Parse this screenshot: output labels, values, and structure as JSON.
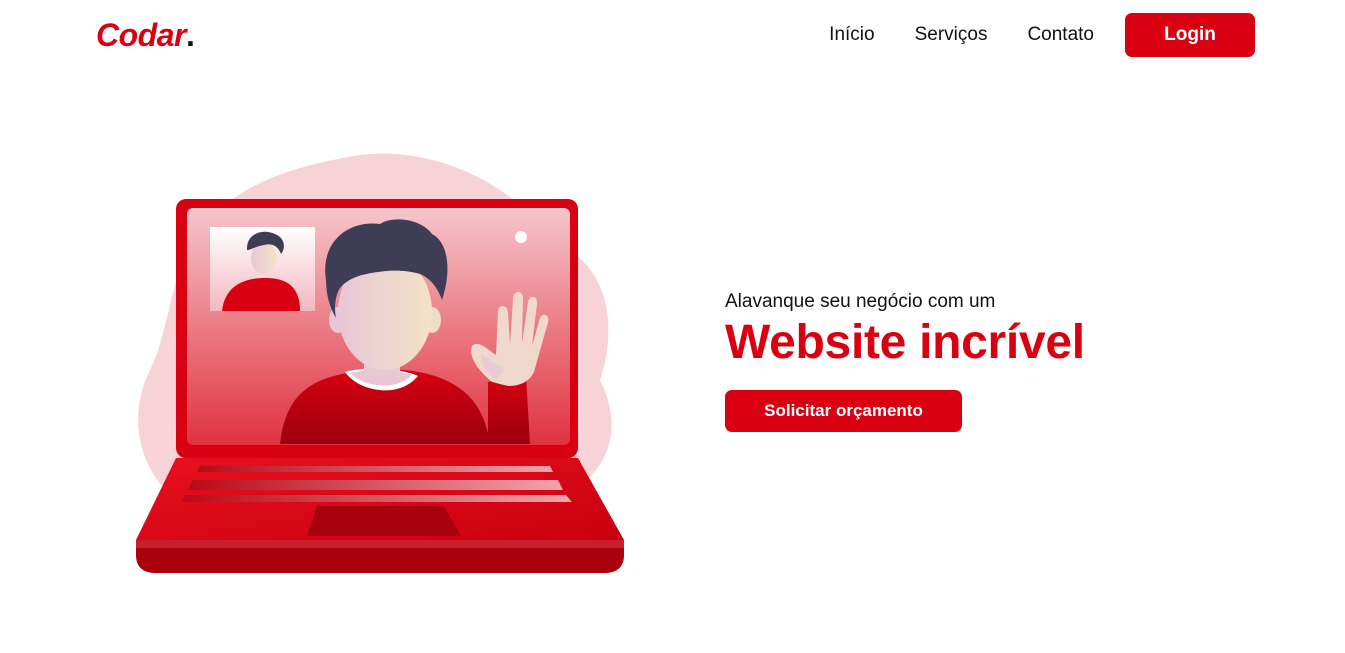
{
  "header": {
    "logo_text": "Codar",
    "logo_dot": ".",
    "nav": {
      "home_label": "Início",
      "services_label": "Serviços",
      "contact_label": "Contato"
    },
    "login_label": "Login"
  },
  "hero": {
    "subtitle": "Alavanque seu negócio com um",
    "title": "Website incrível",
    "cta_label": "Solicitar orçamento"
  },
  "colors": {
    "brand": "#d90012",
    "blob": "#f7d3d8",
    "hair": "#3f3d56",
    "text": "#111111"
  },
  "illustration": {
    "icons": [
      "laptop-icon",
      "video-call-person-icon",
      "waving-hand-icon"
    ]
  }
}
